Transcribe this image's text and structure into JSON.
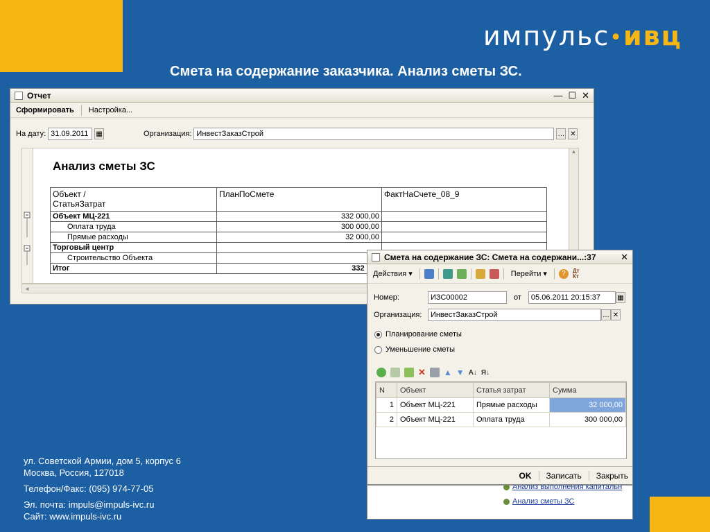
{
  "slide": {
    "title": "Смета на содержание заказчика. Анализ сметы ЗС.",
    "logo_main": "импульс",
    "logo_dot": "•",
    "logo_accent": "ивц",
    "accent_color": "#f6b714",
    "background_color": "#1d5fa3"
  },
  "contacts": {
    "line1": "ул. Советской Армии, дом 5, корпус 6",
    "line2": "Москва, Россия, 127018",
    "line3": "Телефон/Факс: (095) 974-77-05",
    "line4": "Эл. почта: impuls@impuls-ivc.ru",
    "line5": "Сайт: www.impuls-ivc.ru"
  },
  "report_window": {
    "title": "Отчет",
    "toolbar": {
      "generate": "Сформировать",
      "settings": "Настройка..."
    },
    "date_label": "На дату:",
    "date_value": "31.09.2011",
    "org_label": "Организация:",
    "org_value": "ИнвестЗаказСтрой",
    "report_title": "Анализ сметы ЗС",
    "columns": [
      "Объект /\nСтатьяЗатрат",
      "ПланПоСмете",
      "ФактНаСчете_08_9"
    ],
    "rows": [
      {
        "name": "Объект МЦ-221",
        "plan": "332 000,00",
        "fact": "",
        "bold": true
      },
      {
        "name": "Оплата труда",
        "plan": "300 000,00",
        "fact": "",
        "bold": false
      },
      {
        "name": "Прямые расходы",
        "plan": "32 000,00",
        "fact": "",
        "bold": false
      },
      {
        "name": "Торговый центр",
        "plan": "",
        "fact": "",
        "bold": true
      },
      {
        "name": "Строительство Объекта",
        "plan": "",
        "fact": "",
        "bold": false
      },
      {
        "name": "Итог",
        "plan": "332 000",
        "fact": "",
        "bold": true
      }
    ]
  },
  "dialog": {
    "title": "Смета на содержание ЗС: Смета на содержани...:37",
    "toolbar": {
      "actions": "Действия",
      "goto": "Перейти"
    },
    "number_label": "Номер:",
    "number_value": "ИЗС00002",
    "from_label": "от",
    "date_value": "05.06.2011 20:15:37",
    "org_label": "Организация:",
    "org_value": "ИнвестЗаказСтрой",
    "radio_planning": "Планирование сметы",
    "radio_reduction": "Уменьшение сметы",
    "grid_headers": [
      "N",
      "Объект",
      "Статья затрат",
      "Сумма"
    ],
    "grid_rows": [
      {
        "n": "1",
        "object": "Объект МЦ-221",
        "article": "Прямые расходы",
        "sum": "32 000,00"
      },
      {
        "n": "2",
        "object": "Объект МЦ-221",
        "article": "Оплата труда",
        "sum": "300 000,00"
      }
    ],
    "buttons": {
      "ok": "OK",
      "save": "Записать",
      "close": "Закрыть"
    }
  },
  "background_links": {
    "link1": "Анализ выполнения капитальн",
    "link2": "Анализ сметы ЗС"
  }
}
